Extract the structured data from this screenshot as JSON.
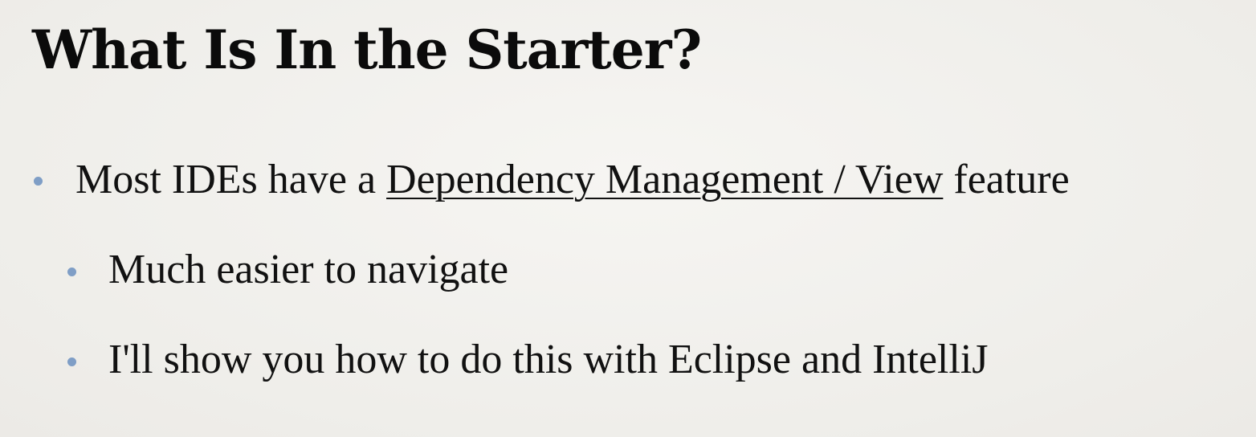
{
  "slide": {
    "title": "What Is In the Starter?",
    "bullets": [
      {
        "level": 1,
        "prefix": "Most IDEs have a ",
        "link_text": "Dependency Management / View",
        "suffix": " feature"
      },
      {
        "level": 2,
        "text": "Much easier to navigate"
      },
      {
        "level": 2,
        "text": "I'll show you how to do this with Eclipse and IntelliJ"
      }
    ]
  },
  "colors": {
    "background": "#f1f0ec",
    "bullet_dot": "#7f9ec6",
    "text": "#111111"
  }
}
